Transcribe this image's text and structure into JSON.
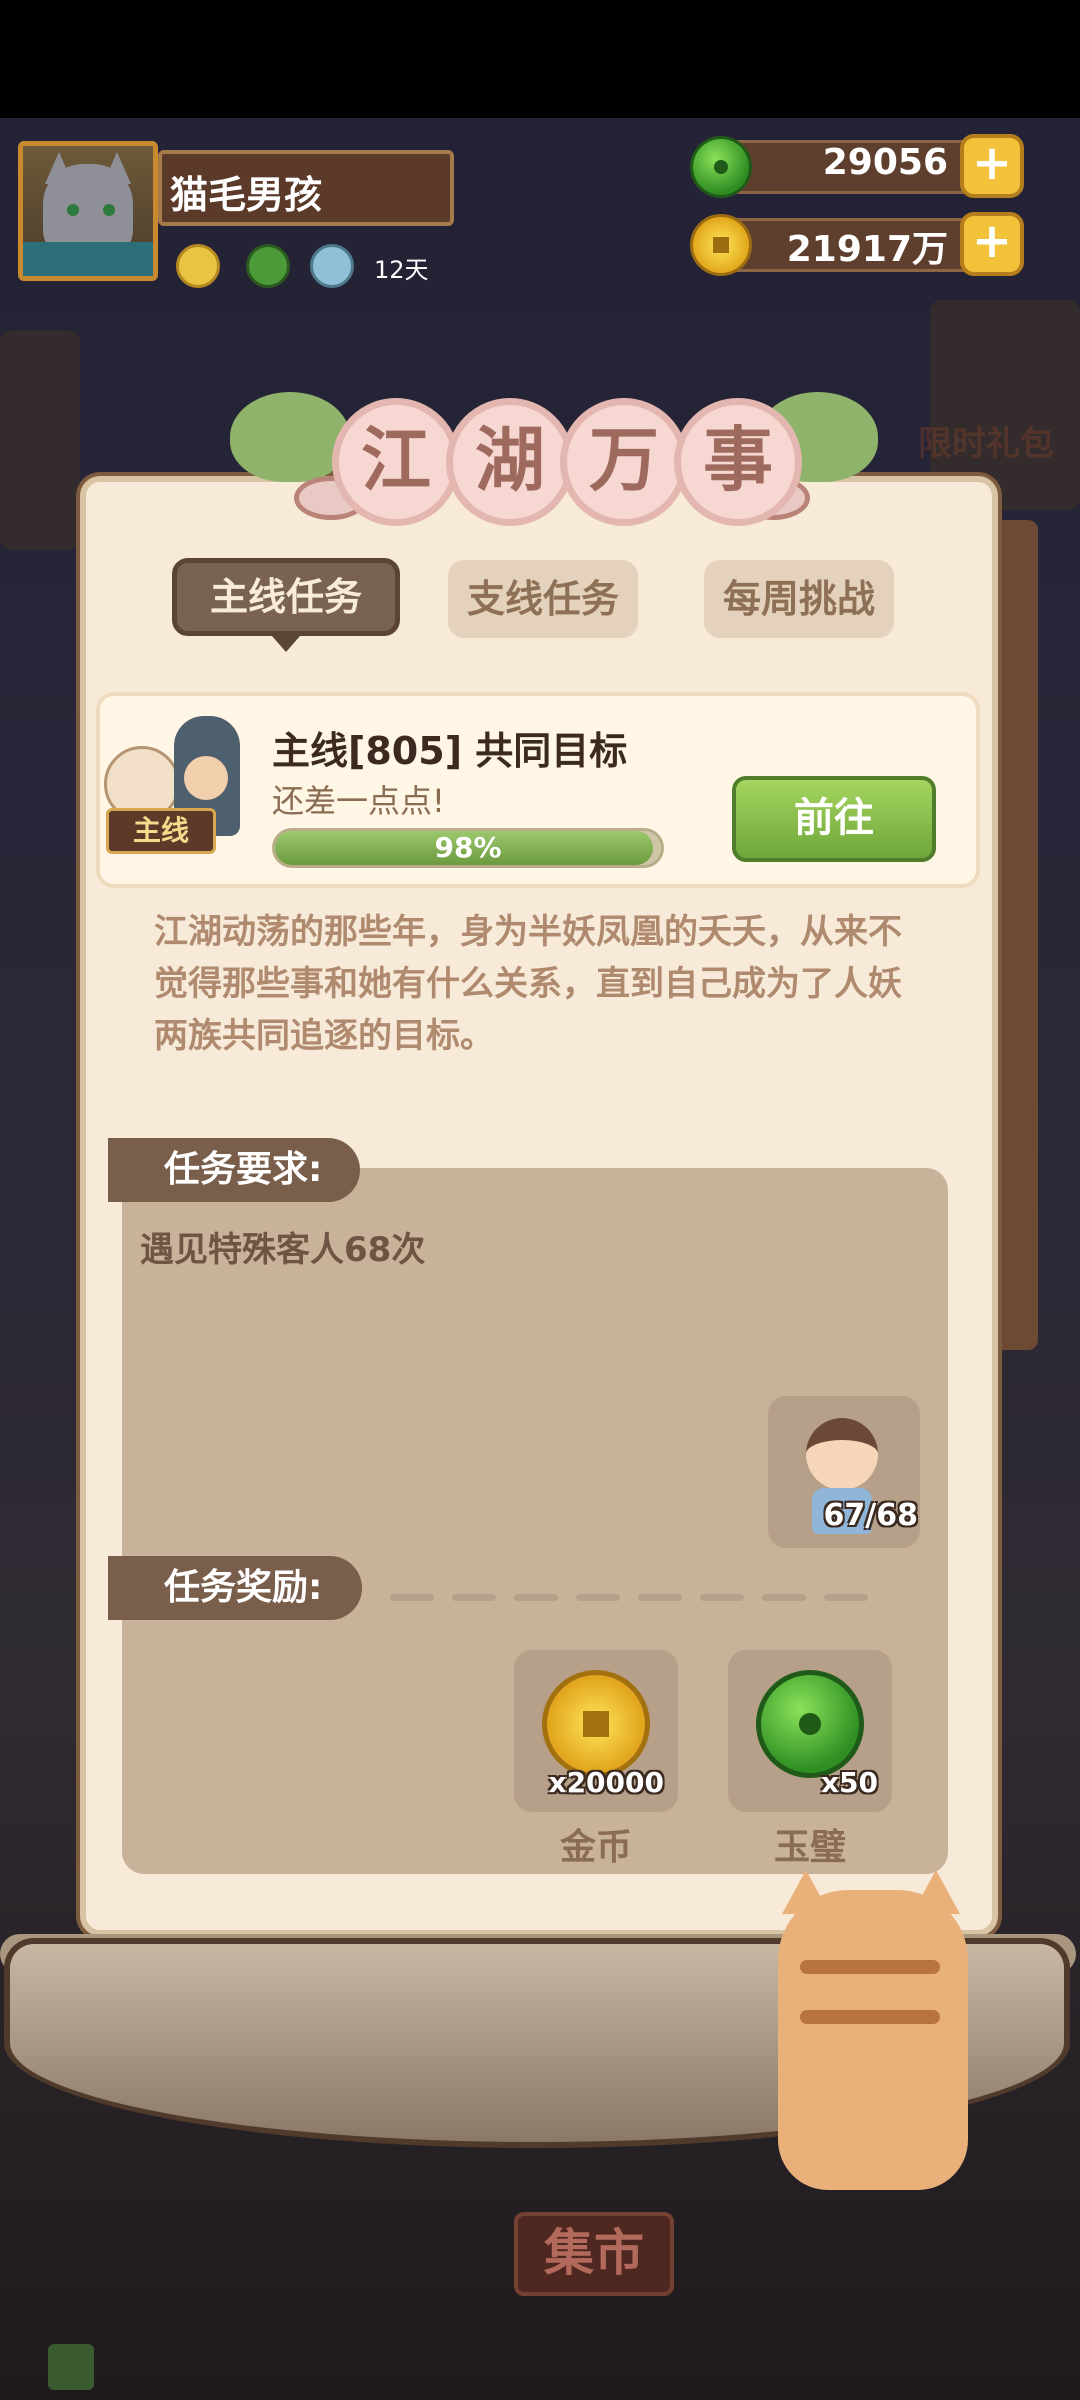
{
  "player": {
    "name": "猫毛男孩",
    "buff_days": "12天"
  },
  "currency": {
    "jade": "29056",
    "gold": "21917万"
  },
  "background": {
    "event_banner": "限时礼包",
    "market": "集市"
  },
  "panel": {
    "title_chars": [
      "江",
      "湖",
      "万",
      "事"
    ],
    "tabs": [
      "主线任务",
      "支线任务",
      "每周挑战"
    ],
    "active_tab": "主线任务"
  },
  "quest": {
    "tag": "主线",
    "title": "主线[805] 共同目标",
    "subtitle": "还差一点点!",
    "progress": 0.98,
    "progress_text": "98%",
    "button": "前往",
    "story": "江湖动荡的那些年，身为半妖凤凰的夭夭，从来不觉得那些事和她有什么关系，直到自己成为了人妖两族共同追逐的目标。"
  },
  "requirement": {
    "label": "任务要求:",
    "text": "遇见特殊客人68次",
    "count": "67/68"
  },
  "rewards": {
    "label": "任务奖励:",
    "items": [
      {
        "qty": "x20000",
        "name": "金币",
        "icon": "gold-coin-icon"
      },
      {
        "qty": "x50",
        "name": "玉璧",
        "icon": "jade-bi-icon"
      }
    ]
  },
  "colors": {
    "panel_bg": "#f7ead8",
    "tab_active": "#7a6250",
    "button_green": "#6fa63a",
    "progress_green": "#6c9a3e"
  }
}
